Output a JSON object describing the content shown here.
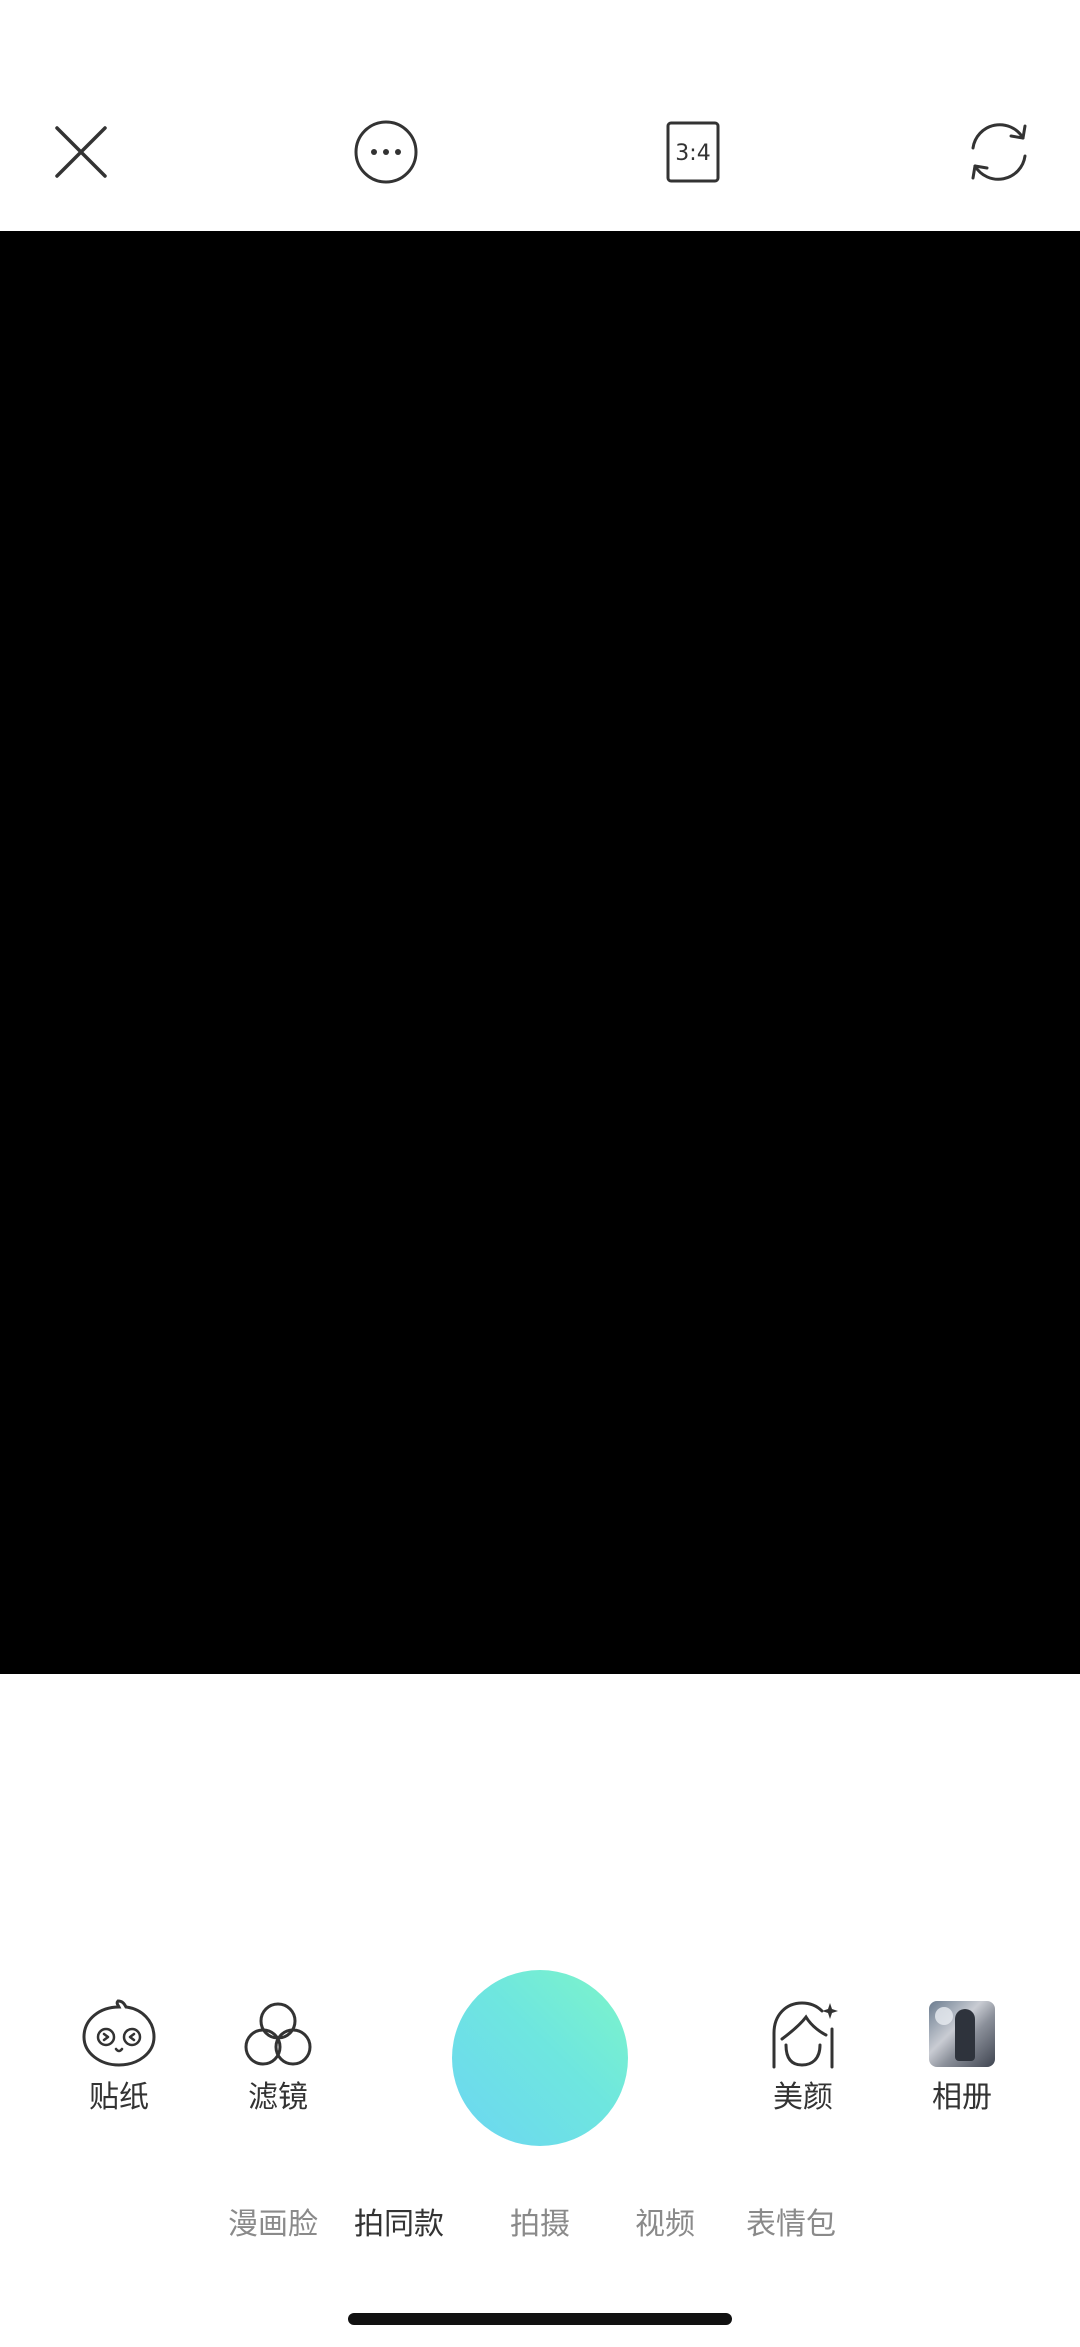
{
  "top_bar": {
    "close_icon": "close-icon",
    "more_icon": "more-options-icon",
    "aspect_ratio_label": "3:4",
    "switch_camera_icon": "switch-camera-icon"
  },
  "tools": {
    "sticker": {
      "label": "贴纸",
      "icon": "sticker-face-icon"
    },
    "filter": {
      "label": "滤镜",
      "icon": "filter-circles-icon"
    },
    "beauty": {
      "label": "美颜",
      "icon": "beauty-face-icon"
    },
    "album": {
      "label": "相册",
      "icon": "album-thumbnail"
    }
  },
  "shutter": {
    "colors": [
      "#7ef5c8",
      "#6cd6f2"
    ]
  },
  "modes": {
    "items": [
      {
        "label": "漫画脸",
        "active": false
      },
      {
        "label": "拍同款",
        "active": true
      },
      {
        "label": "拍摄",
        "active": false
      },
      {
        "label": "视频",
        "active": false
      },
      {
        "label": "表情包",
        "active": false
      }
    ]
  },
  "colors": {
    "preview_background": "#000000",
    "icon_stroke": "#333333",
    "inactive_mode": "#8a8a8a"
  }
}
